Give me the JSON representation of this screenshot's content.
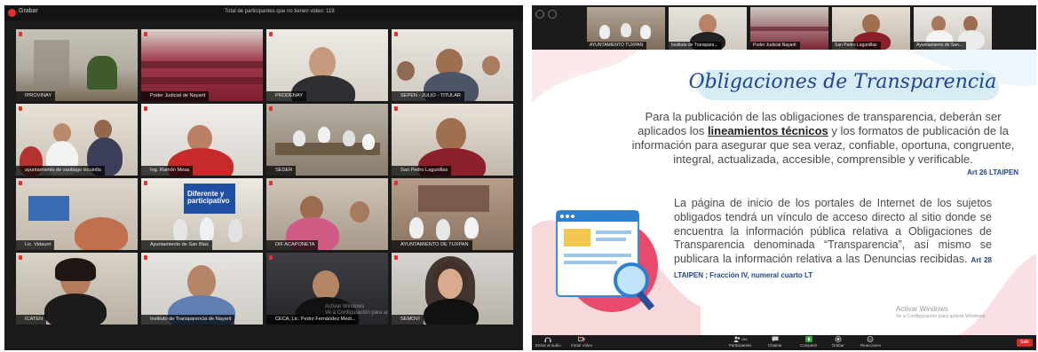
{
  "left_panel": {
    "record_label": "Grabar",
    "participants_label": "Total de participantes que no tienen video: 119",
    "tiles": [
      {
        "name": "IPROVINAY"
      },
      {
        "name": "Poder Judicial de Nayarit"
      },
      {
        "name": "PRODENAY"
      },
      {
        "name": "SEPEN - JULIO - TITULAR"
      },
      {
        "name": "ayuntamiento de santiago ixcuintla"
      },
      {
        "name": "Ing. Ramón Mesa"
      },
      {
        "name": "SEDER"
      },
      {
        "name": "San Pedro Lagunillas"
      },
      {
        "name": "Lic. Vidaurri"
      },
      {
        "name": "Ayuntamiento de San Blas"
      },
      {
        "name": "DIF ACAPONETA"
      },
      {
        "name": "AYUNTAMIENTO DE TUXPAN"
      },
      {
        "name": "ICATEN"
      },
      {
        "name": "Instituto de Transparencia de Nayarit"
      },
      {
        "name": "CECA, Lic. Pedro Fernández Medi..."
      },
      {
        "name": "SEMOVI"
      }
    ],
    "banner_text": "Diferente y participativo",
    "watermark": "Activar Windows\nVe a Configuración para activar Windows."
  },
  "right_panel": {
    "thumbs": [
      {
        "name": "AYUNTAMIENTO TUXPAN"
      },
      {
        "name": "Instituto de Transpare..."
      },
      {
        "name": "Poder Judicial Nayarit"
      },
      {
        "name": "San Pedro Lagunillas"
      },
      {
        "name": "Ayuntamiento de San..."
      }
    ],
    "slide": {
      "title": "Obligaciones de Transparencia",
      "para1_before": "Para la publicación de las obligaciones de transparencia, deberán ser aplicados los ",
      "para1_bold": "lineamientos técnicos",
      "para1_after": " y los formatos de publicación de la información para asegurar que sea veraz, confiable, oportuna, congruente, integral, actualizada, accesible, comprensible y verificable.",
      "cite1": "Art 26 LTAIPEN",
      "para2": "La página de inicio de los portales de Internet de los sujetos obligados tendrá un vínculo de acceso directo al sitio donde se encuentra la información pública relativa a Obligaciones de Transparencia denominada “Transparencia”, así mismo se publicara la información relativa a las Denuncias recibidas.",
      "cite2": "Art 28 LTAIPEN ; Fracción IV, numeral cuarto LT",
      "activate_title": "Activar Windows",
      "activate_sub": "Ve a Configuración para activar Windows."
    },
    "toolbar": {
      "audio": "Entrar al audio",
      "video": "Iniciar Video",
      "participants": "Participantes",
      "participants_count": "159",
      "chat": "Chatear",
      "share": "Compartir",
      "record": "Grabar",
      "reactions": "Reacciones",
      "leave": "Salir"
    }
  },
  "colors": {
    "accent_green": "#2ea043",
    "leave_red": "#d82b25",
    "slide_title_blue": "#22438e",
    "active_speaker": "#c9e64b"
  }
}
